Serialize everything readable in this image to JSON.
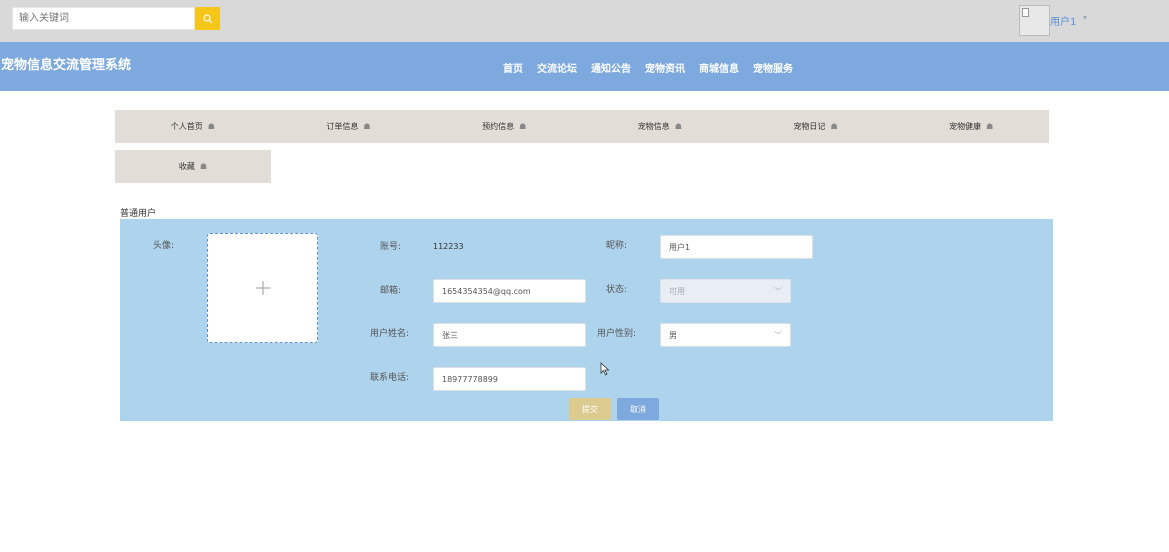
{
  "topbar": {
    "search_placeholder": "输入关键词",
    "search_icon": "search-icon",
    "user_name": "用户1",
    "caret_icon": "chevron-down-icon"
  },
  "navbar": {
    "site_title": "宠物信息交流管理系统",
    "links": [
      "首页",
      "交流论坛",
      "通知公告",
      "宠物资讯",
      "商城信息",
      "宠物服务"
    ]
  },
  "menu": {
    "items": [
      "个人首页",
      "订单信息",
      "预约信息",
      "宠物信息",
      "宠物日记",
      "宠物健康",
      "收藏"
    ],
    "item_icon": "home-icon"
  },
  "section_label": "普通用户",
  "form": {
    "avatar_label": "头像:",
    "account_label": "账号:",
    "account_value": "112233",
    "nickname_label": "昵称:",
    "nickname_value": "用户1",
    "email_label": "邮箱:",
    "email_value": "1654354354@qq.com",
    "status_label": "状态:",
    "status_value": "可用",
    "realname_label": "用户姓名:",
    "realname_value": "张三",
    "gender_label": "用户性别:",
    "gender_value": "男",
    "phone_label": "联系电话:",
    "phone_value": "18977778899",
    "submit_label": "提交",
    "cancel_label": "取消"
  },
  "colors": {
    "topbar_bg": "#d9d9d9",
    "navbar_bg": "#7ea9de",
    "menu_bg": "#e3ddd8",
    "form_bg": "#aed3ec",
    "search_button": "#f5c518",
    "submit_button": "#dccb8f",
    "cancel_button": "#7ea9de"
  }
}
